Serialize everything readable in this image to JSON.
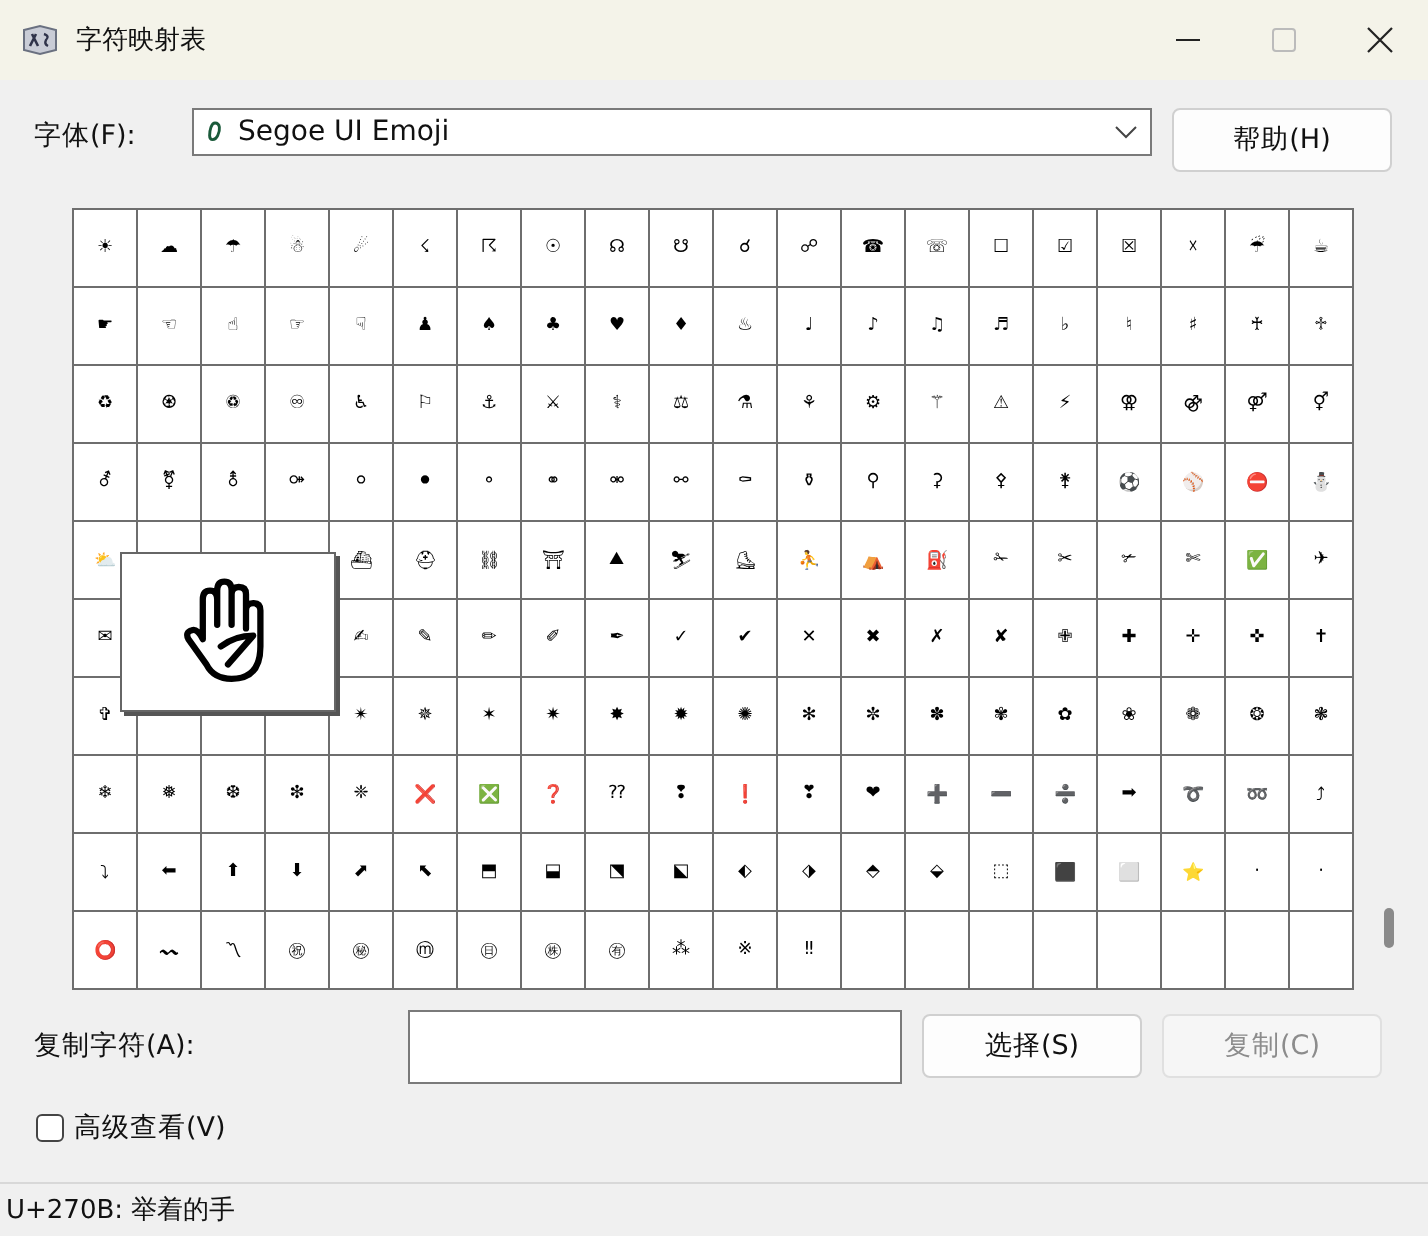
{
  "window": {
    "title": "字符映射表"
  },
  "font_row": {
    "label": "字体(F):",
    "value": "Segoe UI Emoji",
    "help_button": "帮助(H)"
  },
  "grid": {
    "rows": [
      [
        "☀",
        "☁",
        "☂",
        "☃",
        "☄",
        "☇",
        "☈",
        "☉",
        "☊",
        "☋",
        "☌",
        "☍",
        "☎",
        "☏",
        "☐",
        "☑",
        "☒",
        "☓",
        "☔",
        "☕"
      ],
      [
        "☛",
        "☜",
        "☝",
        "☞",
        "☟",
        "♟",
        "♠",
        "♣",
        "♥",
        "♦",
        "♨",
        "♩",
        "♪",
        "♫",
        "♬",
        "♭",
        "♮",
        "♯",
        "♰",
        "♱"
      ],
      [
        "♻",
        "♼",
        "♽",
        "♾",
        "♿",
        "⚐",
        "⚓",
        "⚔",
        "⚕",
        "⚖",
        "⚗",
        "⚘",
        "⚙",
        "⚚",
        "⚠",
        "⚡",
        "⚢",
        "⚣",
        "⚤",
        "⚥"
      ],
      [
        "⚦",
        "⚧",
        "⚨",
        "⚩",
        "⚪",
        "⚫",
        "⚬",
        "⚭",
        "⚮",
        "⚯",
        "⚰",
        "⚱",
        "⚲",
        "⚳",
        "⚴",
        "⚵",
        "⚽",
        "⚾",
        "⛔",
        "⛄"
      ],
      [
        "⛅",
        null,
        null,
        null,
        "⛴",
        "⛑",
        "⛓",
        "⛩",
        "⛰",
        "⛷",
        "⛸",
        "⛹",
        "⛺",
        "⛽",
        "✁",
        "✂",
        "✃",
        "✄",
        "✅",
        "✈"
      ],
      [
        "✉",
        null,
        null,
        null,
        "✍",
        "✎",
        "✏",
        "✐",
        "✒",
        "✓",
        "✔",
        "✕",
        "✖",
        "✗",
        "✘",
        "✙",
        "✚",
        "✛",
        "✜",
        "✝"
      ],
      [
        "✞",
        null,
        null,
        null,
        "✴",
        "✵",
        "✶",
        "✷",
        "✸",
        "✹",
        "✺",
        "✻",
        "✼",
        "✽",
        "✾",
        "✿",
        "❀",
        "❁",
        "❂",
        "❃"
      ],
      [
        "❄",
        "❅",
        "❆",
        "❇",
        "❈",
        "❌",
        "❎",
        "❓",
        "⁇",
        "❢",
        "❗",
        "❣",
        "❤",
        "➕",
        "➖",
        "➗",
        "➡",
        "➰",
        "➿",
        "⤴"
      ],
      [
        "⤵",
        "⬅",
        "⬆",
        "⬇",
        "⬈",
        "⬉",
        "⬒",
        "⬓",
        "⬔",
        "⬕",
        "⬖",
        "⬗",
        "⬘",
        "⬙",
        "⬚",
        "⬛",
        "⬜",
        "⭐",
        "·",
        "·"
      ],
      [
        "⭕",
        "〰",
        "〽",
        "㊗",
        "㊙",
        "ⓜ",
        "㊐",
        "㊑",
        "㊒",
        "⁂",
        "※",
        "‼"
      ]
    ]
  },
  "copy_row": {
    "label": "复制字符(A):",
    "select_button": "选择(S)",
    "copy_button": {
      "label": "复制(C)",
      "disabled": true
    }
  },
  "advanced_view": {
    "label": "高级查看(V)",
    "checked": false
  },
  "status_bar": "U+270B: 举着的手"
}
